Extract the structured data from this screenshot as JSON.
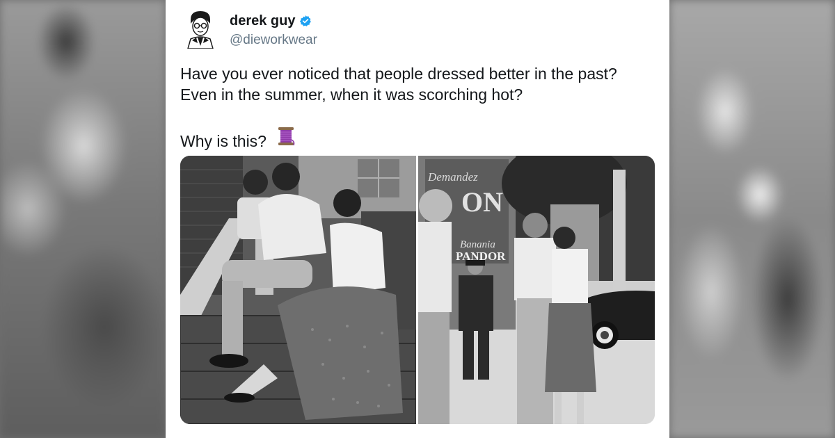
{
  "tweet": {
    "author_name": "derek guy",
    "handle": "@dieworkwear",
    "verified": true,
    "text_lines": [
      "Have you ever noticed that people dressed better in the past?",
      "Even in the summer, when it was scorching hot?"
    ],
    "question": "Why is this?",
    "emoji": "thread-spool-icon"
  },
  "media": {
    "left_photo": "family-on-steps-photo",
    "right_photo": "street-scene-photo",
    "sign_text": {
      "line1": "Demandez",
      "line2": "ON",
      "line3": "Banania",
      "line4": "PANDOR"
    }
  },
  "colors": {
    "name": "#14171a",
    "handle": "#657786",
    "verified_badge": "#1da1f2",
    "card_background": "#ffffff"
  }
}
